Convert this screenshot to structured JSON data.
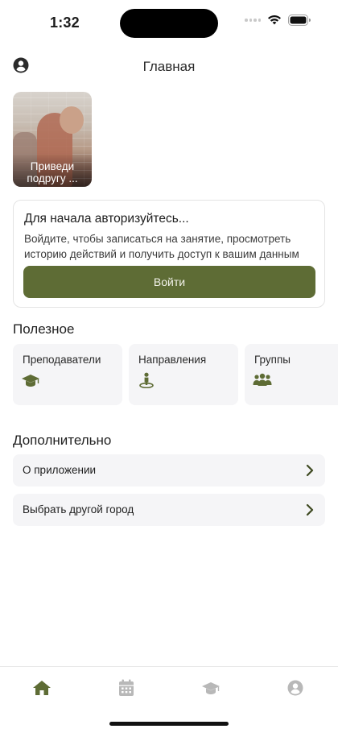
{
  "status_bar": {
    "time": "1:32"
  },
  "header": {
    "title": "Главная",
    "profile_icon": "person-circle-icon"
  },
  "story": {
    "label": "Приведи подругу ..."
  },
  "auth_card": {
    "title": "Для начала авторизуйтесь...",
    "text": "Войдите, чтобы записаться на занятие, просмотреть историю действий и получить доступ к вашим данным",
    "button_label": "Войти"
  },
  "useful": {
    "title": "Полезное",
    "items": [
      {
        "label": "Преподаватели",
        "icon": "graduation-cap-icon"
      },
      {
        "label": "Направления",
        "icon": "person-pin-icon"
      },
      {
        "label": "Группы",
        "icon": "users-icon"
      }
    ]
  },
  "extra": {
    "title": "Дополнительно",
    "items": [
      {
        "label": "О приложении"
      },
      {
        "label": "Выбрать другой город"
      }
    ]
  },
  "tabbar": {
    "tabs": [
      {
        "icon": "home-icon",
        "active": true
      },
      {
        "icon": "calendar-icon",
        "active": false
      },
      {
        "icon": "graduation-cap-icon",
        "active": false
      },
      {
        "icon": "person-circle-icon",
        "active": false
      }
    ]
  },
  "colors": {
    "accent": "#5e6c35",
    "inactive": "#b8b8b8",
    "tile_bg": "#f5f5f7"
  }
}
